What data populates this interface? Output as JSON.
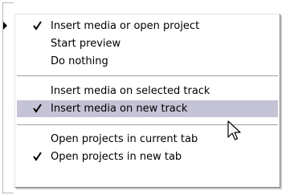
{
  "menu": {
    "groups": [
      {
        "items": [
          {
            "label": "Insert media or open project",
            "checked": true
          },
          {
            "label": "Start preview",
            "checked": false
          },
          {
            "label": "Do nothing",
            "checked": false
          }
        ]
      },
      {
        "items": [
          {
            "label": "Insert media on selected track",
            "checked": false
          },
          {
            "label": "Insert media on new track",
            "checked": true,
            "highlighted": true
          }
        ]
      },
      {
        "items": [
          {
            "label": "Open projects in current tab",
            "checked": false
          },
          {
            "label": "Open projects in new tab",
            "checked": true
          }
        ]
      }
    ]
  },
  "colors": {
    "highlight": "#c5c3d6",
    "text": "#000000",
    "separator": "#a0a0a0"
  },
  "icons": {
    "check": "check-icon",
    "submenu": "submenu-arrow-icon",
    "cursor": "mouse-pointer-icon"
  }
}
